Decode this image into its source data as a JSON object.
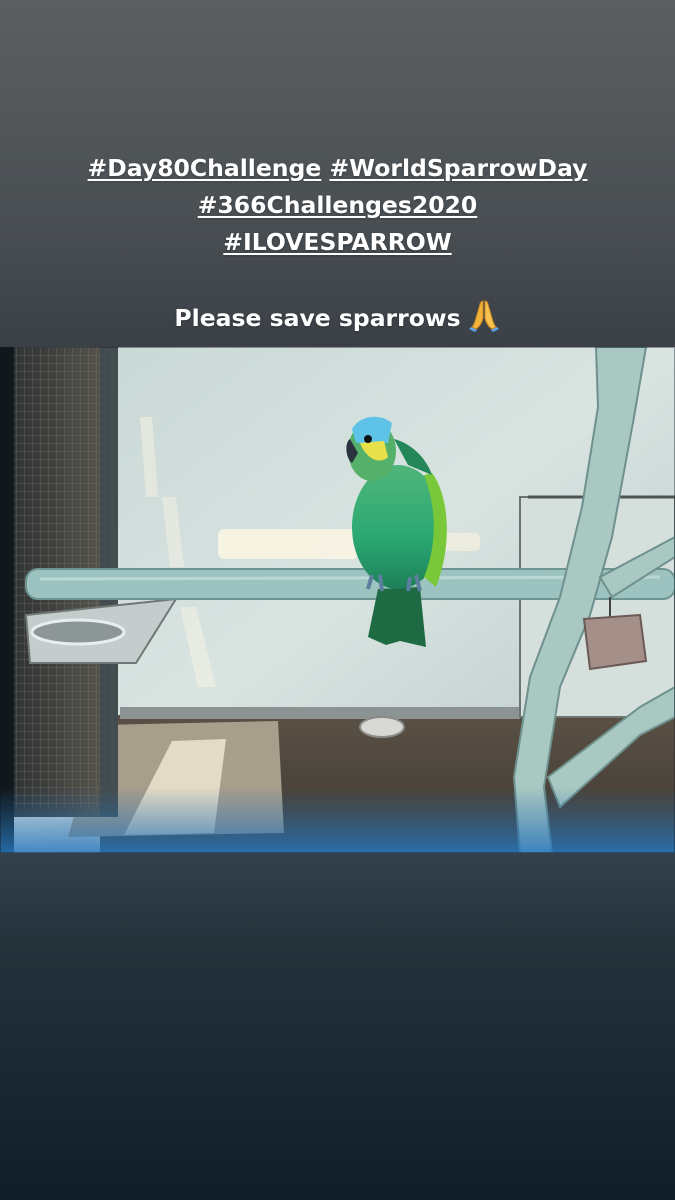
{
  "caption": {
    "tags": [
      "#Day80Challenge",
      "#WorldSparrowDay",
      "#366Challenges2020",
      "#ILOVESPARROW"
    ],
    "message": "Please save sparrows",
    "emoji_icon": "folded-hands-icon"
  },
  "photo": {
    "subject_icon": "parrot-photo"
  },
  "colors": {
    "text": "#ffffff",
    "background_top": "#5b5f62",
    "background_bottom": "#0f1d28",
    "emoji": "#f2b33d"
  }
}
